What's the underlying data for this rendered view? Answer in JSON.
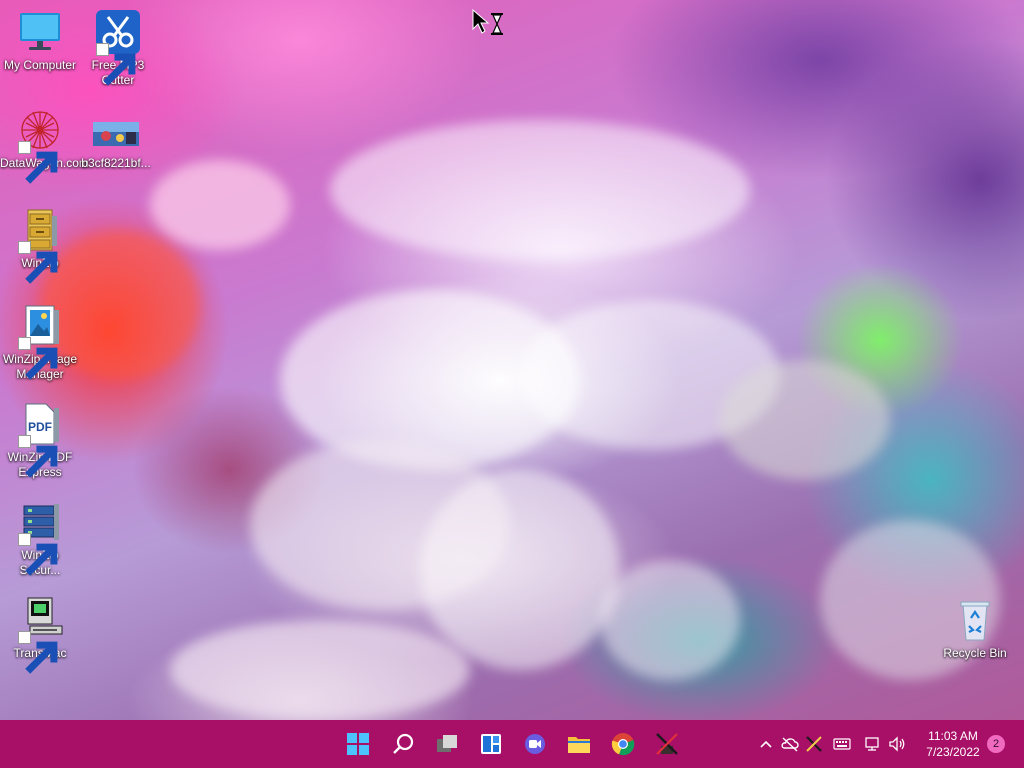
{
  "desktop": {
    "icons": [
      {
        "label": "My Computer",
        "icon": "monitor-icon"
      },
      {
        "label": "Free MP3 Cutter",
        "icon": "scissors-icon"
      },
      {
        "label": "DataWagon.com",
        "icon": "datawagon-icon"
      },
      {
        "label": "b3cf8221bf...",
        "icon": "image-thumbnail-icon"
      },
      {
        "label": "WinZip",
        "icon": "winzip-cabinet-icon"
      },
      {
        "label": "WinZip Image Manager",
        "icon": "image-manager-icon"
      },
      {
        "label": "WinZip PDF Express",
        "icon": "pdf-icon"
      },
      {
        "label": "WinZip Secur...",
        "icon": "secure-backup-icon"
      },
      {
        "label": "TransMac",
        "icon": "mac-computer-icon"
      },
      {
        "label": "Recycle Bin",
        "icon": "recycle-bin-icon"
      }
    ]
  },
  "taskbar": {
    "color": "#a80f66",
    "apps": [
      {
        "name": "Start",
        "icon": "windows-start-icon"
      },
      {
        "name": "Search",
        "icon": "search-icon"
      },
      {
        "name": "Task View",
        "icon": "task-view-icon"
      },
      {
        "name": "Widgets",
        "icon": "widgets-icon"
      },
      {
        "name": "Chat",
        "icon": "chat-icon"
      },
      {
        "name": "File Explorer",
        "icon": "folder-icon"
      },
      {
        "name": "Chrome",
        "icon": "chrome-icon"
      },
      {
        "name": "App",
        "icon": "crossed-app-icon"
      }
    ],
    "tray": {
      "icons": [
        "chevron-up-icon",
        "cloud-off-icon",
        "crossed-app-icon",
        "keyboard-icon",
        "network-icon",
        "volume-icon"
      ],
      "time": "11:03 AM",
      "date": "7/23/2022",
      "notification_count": "2"
    }
  }
}
